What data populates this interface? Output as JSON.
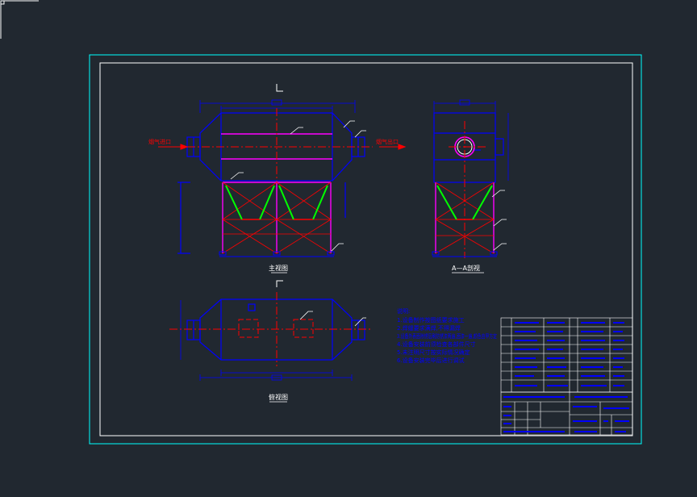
{
  "canvas": {
    "background": "#212830"
  },
  "colors": {
    "outline": "#0000ff",
    "center": "#ff0000",
    "magenta": "#ff00ff",
    "green": "#00ff00",
    "cyan": "#00ffff",
    "white": "#ffffff"
  },
  "drawing": {
    "front_view": {
      "caption": "主视图",
      "inlet_label": "烟气进口",
      "outlet_label": "烟气出口"
    },
    "side_view": {
      "caption": "A—A剖视"
    },
    "top_view": {
      "caption": "俯视图"
    },
    "notes": {
      "title": "说明:",
      "items": [
        "1.设备制作按图纸要求施工",
        "2.焊缝要求满焊,不得漏焊",
        "3.设备外表面除锈后刷防锈漆两遍,面漆一遍,颜色由甲方定",
        "4.设备安装前须检查各部件尺寸",
        "5.未注明尺寸按实际情况确定",
        "6.设备安装完毕后进行调试"
      ]
    }
  }
}
